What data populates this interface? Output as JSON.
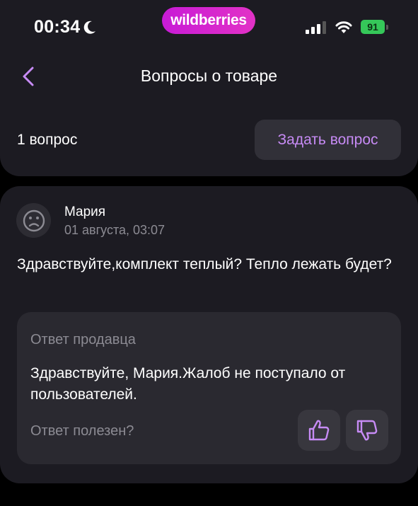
{
  "status_bar": {
    "time": "00:34",
    "brand": "wildberries",
    "battery": "91"
  },
  "header": {
    "title": "Вопросы о товаре",
    "questions_count": "1 вопрос",
    "ask_button_label": "Задать вопрос"
  },
  "question": {
    "author": "Мария",
    "date": "01 августа, 03:07",
    "text": "Здравствуйте,комплект теплый? Тепло лежать будет?",
    "answer": {
      "heading": "Ответ продавца",
      "text": "Здравствуйте, Мария.Жалоб не поступало от пользователей.",
      "helpful_prompt": "Ответ полезен?"
    }
  },
  "icons": {
    "back": "chevron-left-icon",
    "moon": "moon-icon",
    "signal": "signal-icon",
    "wifi": "wifi-icon",
    "avatar": "sad-face-icon",
    "thumbs_up": "thumbs-up-icon",
    "thumbs_down": "thumbs-down-icon"
  },
  "colors": {
    "accent": "#c78bf5",
    "brand_gradient_start": "#c81bd6",
    "brand_gradient_end": "#e232c6",
    "card_background": "#1c1b22",
    "answer_background": "#2a2930",
    "secondary_text": "#8c8b93",
    "battery": "#35c759"
  }
}
